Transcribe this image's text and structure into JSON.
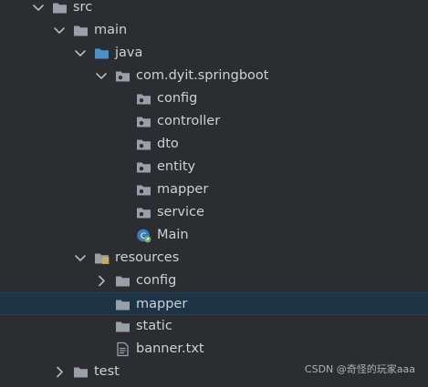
{
  "tree": [
    {
      "label": "src",
      "level": 0,
      "expanded": true,
      "icon": "folder-icon"
    },
    {
      "label": "main",
      "level": 1,
      "expanded": true,
      "icon": "folder-icon"
    },
    {
      "label": "java",
      "level": 2,
      "expanded": true,
      "icon": "source-root-folder-icon"
    },
    {
      "label": "com.dyit.springboot",
      "level": 3,
      "expanded": true,
      "icon": "package-icon"
    },
    {
      "label": "config",
      "level": 4,
      "expanded": null,
      "icon": "package-icon"
    },
    {
      "label": "controller",
      "level": 4,
      "expanded": null,
      "icon": "package-icon"
    },
    {
      "label": "dto",
      "level": 4,
      "expanded": null,
      "icon": "package-icon"
    },
    {
      "label": "entity",
      "level": 4,
      "expanded": null,
      "icon": "package-icon"
    },
    {
      "label": "mapper",
      "level": 4,
      "expanded": null,
      "icon": "package-icon"
    },
    {
      "label": "service",
      "level": 4,
      "expanded": null,
      "icon": "package-icon"
    },
    {
      "label": "Main",
      "level": 4,
      "expanded": null,
      "icon": "spring-boot-class-icon"
    },
    {
      "label": "resources",
      "level": 2,
      "expanded": true,
      "icon": "resources-folder-icon"
    },
    {
      "label": "config",
      "level": 3,
      "expanded": false,
      "icon": "folder-icon"
    },
    {
      "label": "mapper",
      "level": 3,
      "expanded": null,
      "icon": "folder-icon",
      "selected": true
    },
    {
      "label": "static",
      "level": 3,
      "expanded": null,
      "icon": "folder-icon"
    },
    {
      "label": "banner.txt",
      "level": 3,
      "expanded": null,
      "icon": "text-file-icon"
    },
    {
      "label": "test",
      "level": 1,
      "expanded": false,
      "icon": "folder-icon"
    }
  ],
  "watermark": "CSDN @奇怪的玩家aaa",
  "colors": {
    "background": "#2b2d30",
    "selection": "#1d3346",
    "text": "#ced0d6",
    "folder": "#9aa0a8",
    "source_root": "#4a90c9",
    "spring_green": "#6fb36f"
  }
}
